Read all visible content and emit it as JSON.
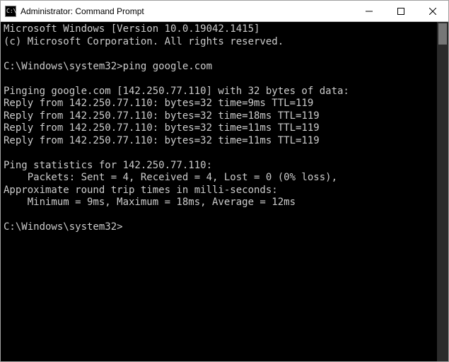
{
  "titlebar": {
    "icon_text": "C:\\.",
    "title": "Administrator: Command Prompt"
  },
  "controls": {
    "minimize": "─",
    "maximize": "☐",
    "close": "✕"
  },
  "terminal": {
    "lines": [
      "Microsoft Windows [Version 10.0.19042.1415]",
      "(c) Microsoft Corporation. All rights reserved.",
      "",
      "C:\\Windows\\system32>ping google.com",
      "",
      "Pinging google.com [142.250.77.110] with 32 bytes of data:",
      "Reply from 142.250.77.110: bytes=32 time=9ms TTL=119",
      "Reply from 142.250.77.110: bytes=32 time=18ms TTL=119",
      "Reply from 142.250.77.110: bytes=32 time=11ms TTL=119",
      "Reply from 142.250.77.110: bytes=32 time=11ms TTL=119",
      "",
      "Ping statistics for 142.250.77.110:",
      "    Packets: Sent = 4, Received = 4, Lost = 0 (0% loss),",
      "Approximate round trip times in milli-seconds:",
      "    Minimum = 9ms, Maximum = 18ms, Average = 12ms",
      ""
    ],
    "prompt": "C:\\Windows\\system32>"
  }
}
